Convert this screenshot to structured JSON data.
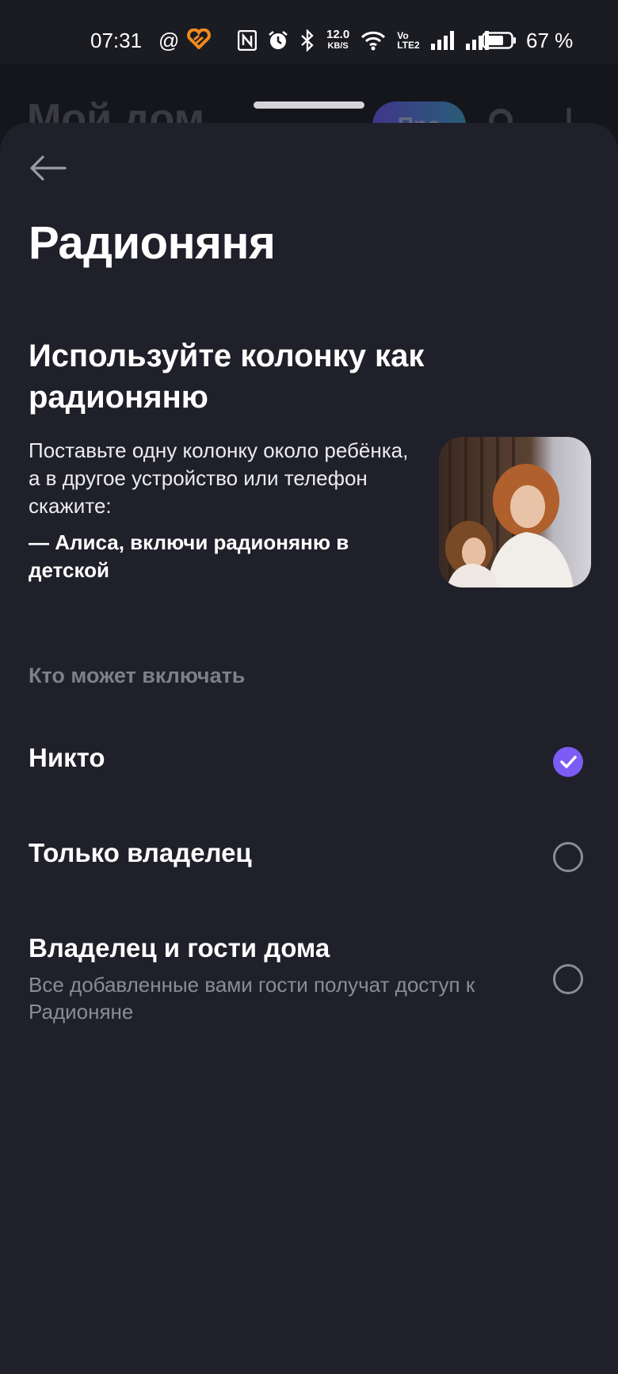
{
  "status_bar": {
    "time": "07:31",
    "at_symbol": "@",
    "net_speed_value": "12.0",
    "net_speed_unit": "KB/S",
    "volte_top": "Vo",
    "volte_bottom": "LTE2",
    "battery_percent": "67 %",
    "icons": [
      "heart-app-icon",
      "nfc-icon",
      "alarm-icon",
      "bluetooth-icon",
      "wifi-icon",
      "signal-icon",
      "signal-icon",
      "battery-icon"
    ]
  },
  "background": {
    "title": "Мой дом",
    "pill_label": "Про"
  },
  "sheet": {
    "page_title": "Радионяня",
    "headline": "Используйте колонку как радионяню",
    "description": "Поставьте одну колонку около ребёнка, а в другое устройство или телефон скажите:",
    "quote": "— Алиса, включи радионяню в детской",
    "section_label": "Кто может включать",
    "options": [
      {
        "title": "Никто",
        "subtitle": "",
        "selected": true
      },
      {
        "title": "Только владелец",
        "subtitle": "",
        "selected": false
      },
      {
        "title": "Владелец и гости дома",
        "subtitle": "Все добавленные вами гости получат доступ к Радионяне",
        "selected": false
      }
    ]
  },
  "colors": {
    "accent": "#7b5cf5",
    "sheet_bg": "#1f2029",
    "secondary_text": "#8a8c97"
  }
}
